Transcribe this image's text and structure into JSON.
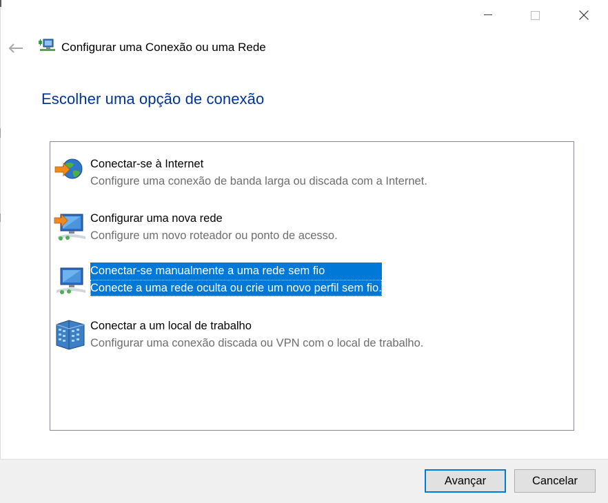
{
  "window": {
    "title": "Configurar uma Conexão ou uma Rede",
    "caption_buttons": [
      "minimize",
      "maximize",
      "close"
    ]
  },
  "heading": "Escolher uma opção de conexão",
  "options": [
    {
      "title": "Conectar-se à Internet",
      "description": "Configure uma conexão de banda larga ou discada com a Internet.",
      "icon": "globe-network-icon",
      "selected": false
    },
    {
      "title": "Configurar uma nova rede",
      "description": "Configure um novo roteador ou ponto de acesso.",
      "icon": "new-network-icon",
      "selected": false
    },
    {
      "title": "Conectar-se manualmente a uma rede sem fio",
      "description": "Conecte a uma rede oculta ou crie um novo perfil sem fio.",
      "icon": "wireless-network-icon",
      "selected": true
    },
    {
      "title": "Conectar a um local de trabalho",
      "description": "Configurar uma conexão discada ou VPN com o local de trabalho.",
      "icon": "workplace-building-icon",
      "selected": false
    }
  ],
  "buttons": {
    "next": "Avançar",
    "cancel": "Cancelar"
  },
  "colors": {
    "heading": "#003399",
    "selection": "#0078d7",
    "description": "#6d6d6d",
    "footer": "#f0f0f0"
  }
}
